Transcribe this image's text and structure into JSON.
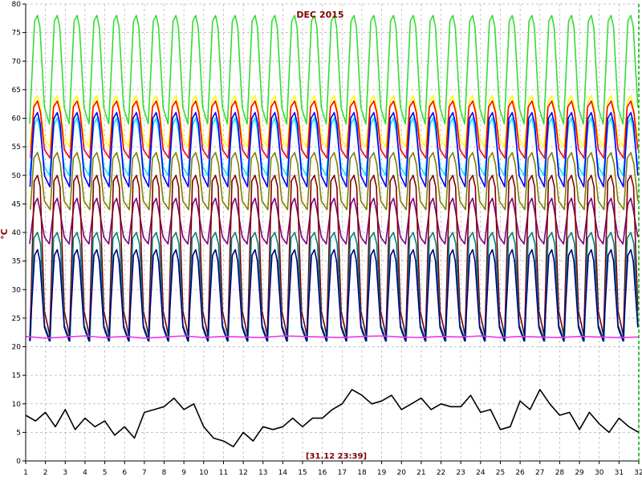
{
  "chart_data": {
    "type": "line",
    "title": "DEC 2015",
    "timestamp": "[31.12 23:39]",
    "ylabel": "°C",
    "xlabel": "",
    "xlim": [
      1,
      32
    ],
    "ylim": [
      0,
      80
    ],
    "x_ticks": [
      1,
      2,
      3,
      4,
      5,
      6,
      7,
      8,
      9,
      10,
      11,
      12,
      13,
      14,
      15,
      16,
      17,
      18,
      19,
      20,
      21,
      22,
      23,
      24,
      25,
      26,
      27,
      28,
      29,
      30,
      31,
      32
    ],
    "y_ticks": [
      0,
      5,
      10,
      15,
      20,
      25,
      30,
      35,
      40,
      45,
      50,
      55,
      60,
      65,
      70,
      75,
      80
    ],
    "grid": true,
    "legend": "none",
    "daily_cycles": {
      "peak_days": [
        1.6,
        2.6,
        3.6,
        4.6,
        5.6,
        6.6,
        7.6,
        8.6,
        9.6,
        10.6,
        11.6,
        12.6,
        13.6,
        14.6,
        15.6,
        16.6,
        17.6,
        18.6,
        19.6,
        20.6,
        21.6,
        22.6,
        23.6,
        24.6,
        25.6,
        26.6,
        27.6,
        28.6,
        29.6,
        30.6,
        31.6
      ],
      "series": [
        {
          "name": "",
          "color": "#33dd33",
          "base": 59,
          "peak": 78
        },
        {
          "name": "",
          "color": "#ffff00",
          "base": 55,
          "peak": 64
        },
        {
          "name": "",
          "color": "#ff0000",
          "base": 53,
          "peak": 63
        },
        {
          "name": "",
          "color": "#00e5ff",
          "base": 50,
          "peak": 60
        },
        {
          "name": "",
          "color": "#0000ff",
          "base": 48,
          "peak": 61
        },
        {
          "name": "",
          "color": "#808000",
          "base": 44,
          "peak": 54
        },
        {
          "name": "",
          "color": "#800080",
          "base": 38,
          "peak": 46
        },
        {
          "name": "",
          "color": "#800000",
          "base": 22,
          "peak": 50
        },
        {
          "name": "",
          "color": "#008080",
          "base": 21,
          "peak": 40
        },
        {
          "name": "",
          "color": "#000080",
          "base": 21,
          "peak": 37
        }
      ]
    },
    "series": [
      {
        "name": "",
        "color": "#ee33ee",
        "x": [
          1,
          2,
          3,
          4,
          5,
          6,
          7,
          8,
          9,
          10,
          11,
          12,
          13,
          14,
          15,
          16,
          17,
          18,
          19,
          20,
          21,
          22,
          23,
          24,
          25,
          26,
          27,
          28,
          29,
          30,
          31,
          32
        ],
        "y": [
          21.8,
          21.5,
          21.7,
          21.9,
          21.6,
          21.8,
          21.5,
          21.7,
          21.9,
          21.6,
          21.8,
          21.7,
          21.6,
          21.9,
          21.8,
          21.7,
          21.6,
          21.8,
          21.9,
          21.7,
          21.6,
          21.8,
          21.7,
          21.9,
          21.6,
          21.8,
          21.7,
          21.6,
          21.8,
          21.7,
          21.6,
          21.7
        ]
      },
      {
        "name": "",
        "color": "#000000",
        "x": [
          1,
          1.5,
          2,
          2.5,
          3,
          3.5,
          4,
          4.5,
          5,
          5.5,
          6,
          6.5,
          7,
          7.5,
          8,
          8.5,
          9,
          9.5,
          10,
          10.5,
          11,
          11.5,
          12,
          12.5,
          13,
          13.5,
          14,
          14.5,
          15,
          15.5,
          16,
          16.5,
          17,
          17.5,
          18,
          18.5,
          19,
          19.5,
          20,
          20.5,
          21,
          21.5,
          22,
          22.5,
          23,
          23.5,
          24,
          24.5,
          25,
          25.5,
          26,
          26.5,
          27,
          27.5,
          28,
          28.5,
          29,
          29.5,
          30,
          30.5,
          31,
          31.5,
          32
        ],
        "y": [
          8,
          7,
          8.5,
          6,
          9,
          5.5,
          7.5,
          6,
          7,
          4.5,
          6,
          4,
          8.5,
          9,
          9.5,
          11,
          9,
          10,
          6,
          4,
          3.5,
          2.5,
          5,
          3.5,
          6,
          5.5,
          6,
          7.5,
          6,
          7.5,
          7.5,
          9,
          10,
          12.5,
          11.5,
          10,
          10.5,
          11.5,
          9,
          10,
          11,
          9,
          10,
          9.5,
          9.5,
          11.5,
          8.5,
          9,
          5.5,
          6,
          10.5,
          9,
          12.5,
          10,
          8,
          8.5,
          5.5,
          8.5,
          6.5,
          5,
          7.5,
          6,
          5
        ]
      }
    ]
  }
}
